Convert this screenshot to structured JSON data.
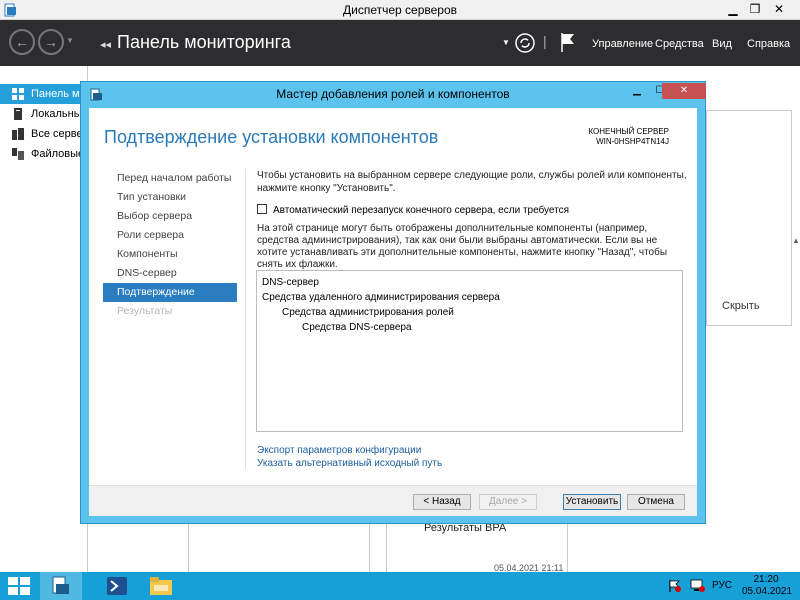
{
  "server_manager": {
    "window_title": "Диспетчер серверов",
    "page_title": "Панель мониторинга",
    "menu": {
      "manage": "Управление",
      "tools": "Средства",
      "view": "Вид",
      "help": "Справка"
    },
    "sidebar": [
      {
        "label": "Панель мониторинга",
        "icon": "dashboard-icon"
      },
      {
        "label": "Локальный сервер",
        "icon": "local-server-icon"
      },
      {
        "label": "Все серверы",
        "icon": "all-servers-icon"
      },
      {
        "label": "Файловые службы",
        "icon": "file-services-icon"
      }
    ],
    "hide_label": "Скрыть",
    "bpa_label": "Результаты BPA",
    "bpa_date": "05.04.2021 21:11"
  },
  "wizard": {
    "title": "Мастер добавления ролей и компонентов",
    "heading": "Подтверждение установки компонентов",
    "destination_label": "КОНЕЧНЫЙ СЕРВЕР",
    "destination_server": "WIN-0HSHP4TN14J",
    "steps": [
      {
        "label": "Перед началом работы",
        "state": "normal"
      },
      {
        "label": "Тип установки",
        "state": "normal"
      },
      {
        "label": "Выбор сервера",
        "state": "normal"
      },
      {
        "label": "Роли сервера",
        "state": "normal"
      },
      {
        "label": "Компоненты",
        "state": "normal"
      },
      {
        "label": "DNS-сервер",
        "state": "normal"
      },
      {
        "label": "Подтверждение",
        "state": "active"
      },
      {
        "label": "Результаты",
        "state": "disabled"
      }
    ],
    "intro_text": "Чтобы установить на выбранном сервере следующие роли, службы ролей или компоненты, нажмите кнопку \"Установить\".",
    "restart_checkbox_label": "Автоматический перезапуск конечного сервера, если требуется",
    "restart_checked": false,
    "note_text": "На этой странице могут быть отображены дополнительные компоненты (например, средства администрирования), так как они были выбраны автоматически. Если вы не хотите устанавливать эти дополнительные компоненты, нажмите кнопку \"Назад\", чтобы снять их флажки.",
    "components": [
      {
        "label": "DNS-сервер",
        "level": 0
      },
      {
        "label": "Средства удаленного администрирования сервера",
        "level": 0
      },
      {
        "label": "Средства администрирования ролей",
        "level": 1
      },
      {
        "label": "Средства DNS-сервера",
        "level": 2
      }
    ],
    "export_link": "Экспорт параметров конфигурации",
    "alt_source_link": "Указать альтернативный исходный путь",
    "buttons": {
      "back": "< Назад",
      "next": "Далее >",
      "install": "Установить",
      "cancel": "Отмена"
    }
  },
  "taskbar": {
    "lang": "РУС",
    "time": "21:20",
    "date": "05.04.2021"
  },
  "colors": {
    "accent": "#2a7dc0",
    "wizard_frame": "#5bc3ee",
    "taskbar": "#17a0d8",
    "heading": "#2b7ab5",
    "close_button": "#c75050"
  }
}
